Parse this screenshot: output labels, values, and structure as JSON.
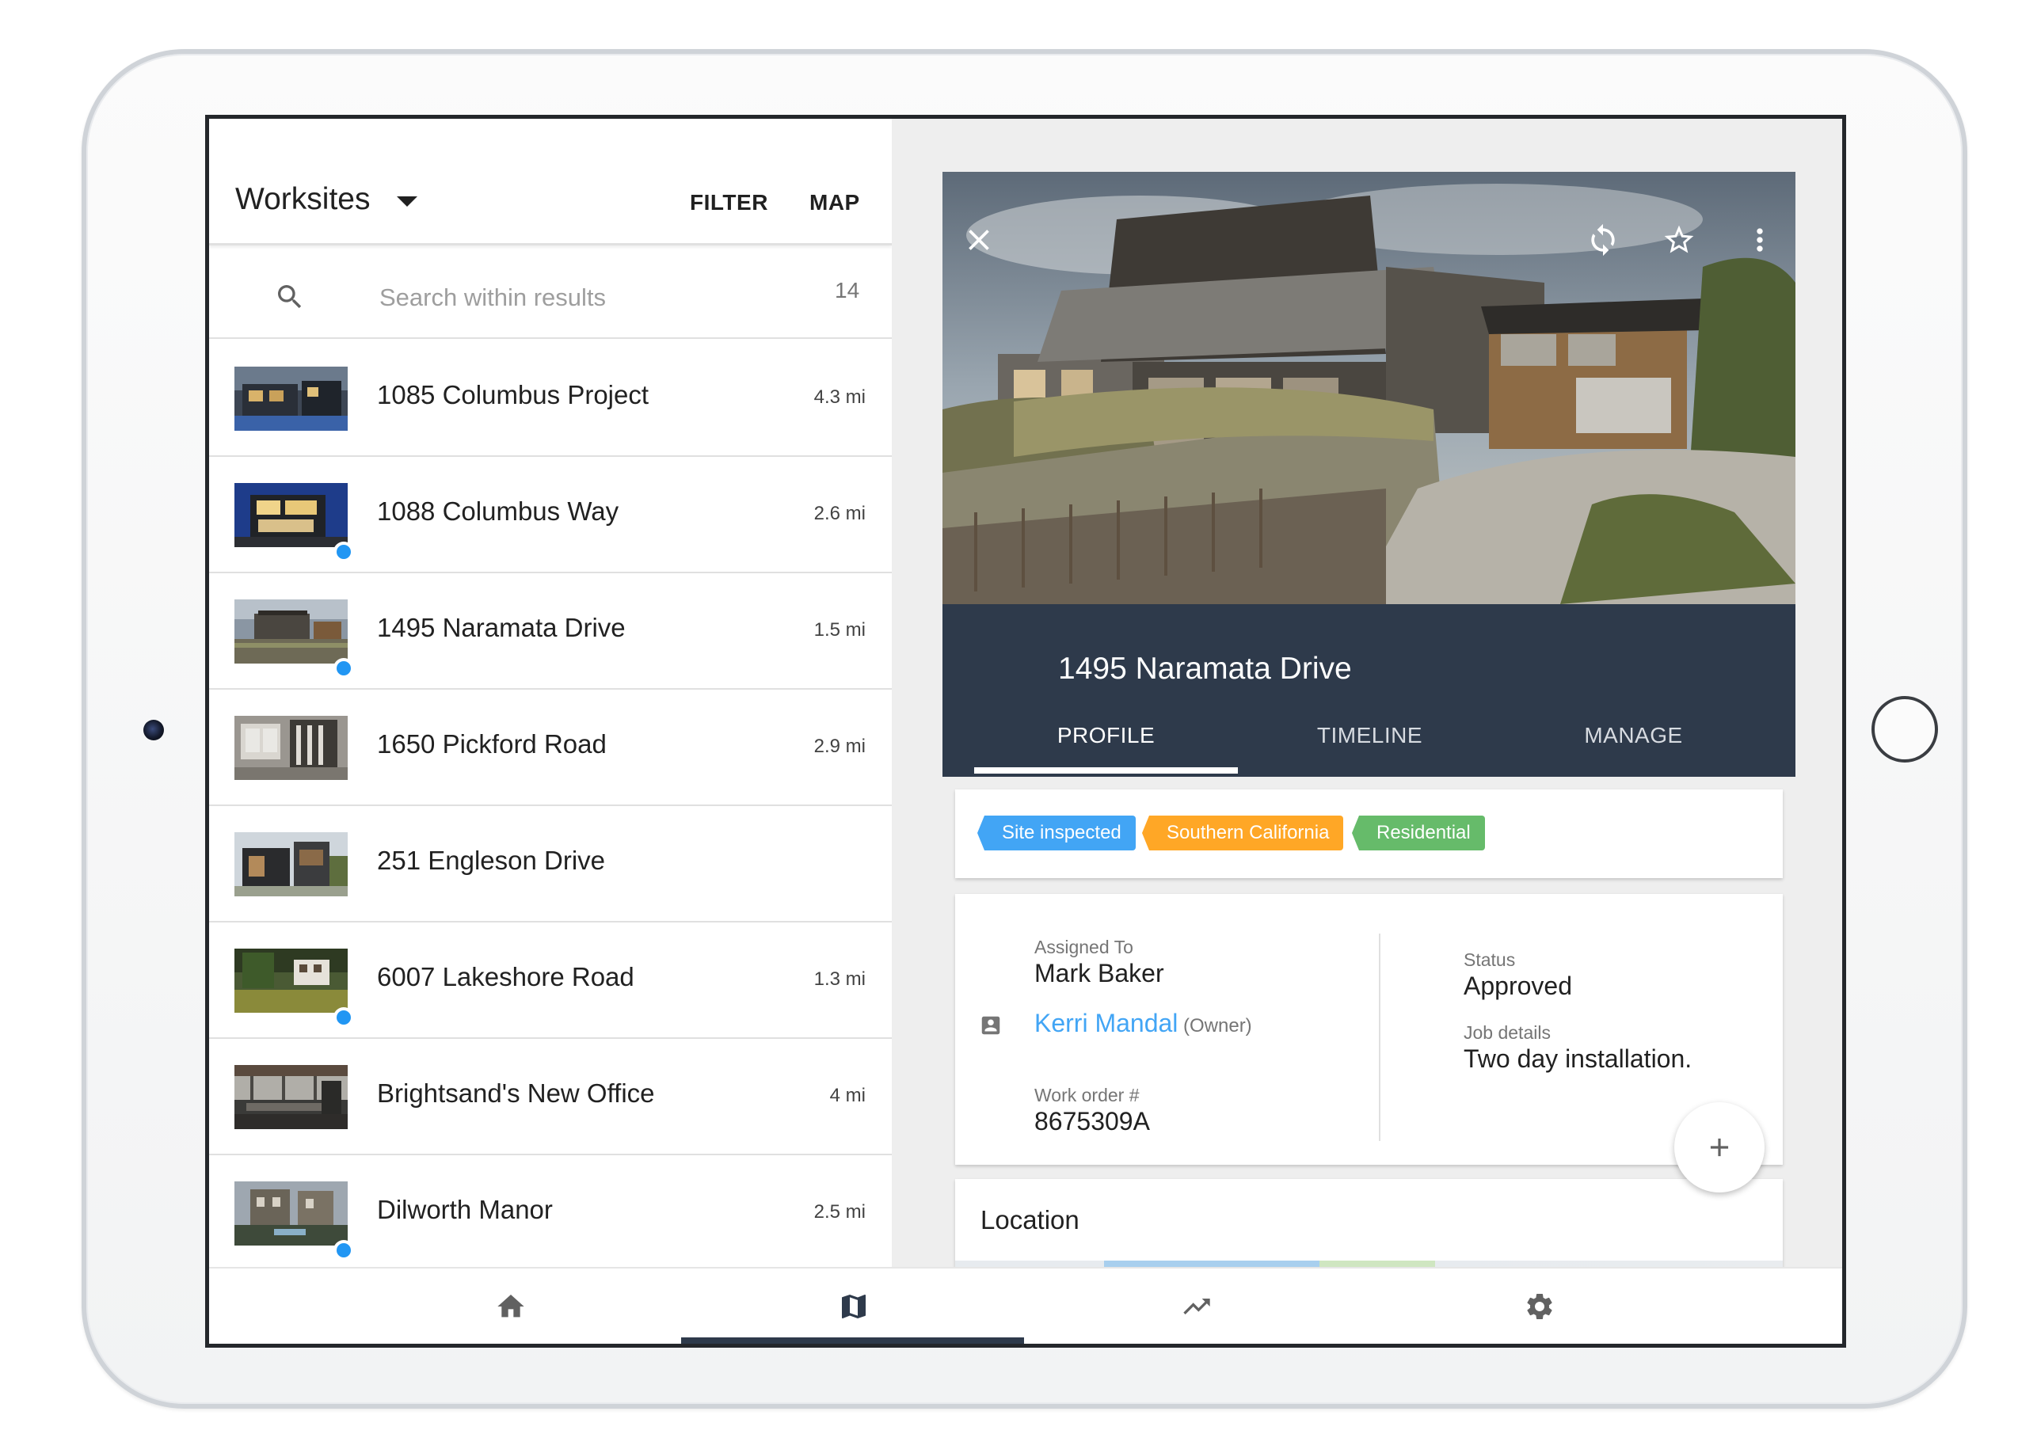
{
  "header": {
    "title": "Worksites",
    "filter_label": "FILTER",
    "map_label": "MAP"
  },
  "search": {
    "placeholder": "Search within results",
    "result_count": "14"
  },
  "worksites": [
    {
      "name": "1085 Columbus Project",
      "distance": "4.3 mi",
      "unread": false
    },
    {
      "name": "1088 Columbus Way",
      "distance": "2.6 mi",
      "unread": true
    },
    {
      "name": "1495 Naramata Drive",
      "distance": "1.5 mi",
      "unread": true
    },
    {
      "name": "1650 Pickford Road",
      "distance": "2.9 mi",
      "unread": false
    },
    {
      "name": "251 Engleson Drive",
      "distance": "",
      "unread": false
    },
    {
      "name": "6007 Lakeshore Road",
      "distance": "1.3 mi",
      "unread": true
    },
    {
      "name": "Brightsand's New Office",
      "distance": "4 mi",
      "unread": false
    },
    {
      "name": "Dilworth Manor",
      "distance": "2.5 mi",
      "unread": true
    }
  ],
  "detail": {
    "title": "1495 Naramata Drive",
    "hero_icons": [
      "close-icon",
      "sync-icon",
      "star-outline-icon",
      "more-vert-icon"
    ],
    "tabs": [
      "PROFILE",
      "TIMELINE",
      "MANAGE"
    ],
    "active_tab": "PROFILE",
    "tags": [
      {
        "label": "Site inspected",
        "color": "#42a5f5"
      },
      {
        "label": "Southern California",
        "color": "#ffa726"
      },
      {
        "label": "Residential",
        "color": "#66bb6a"
      }
    ],
    "assigned_to_label": "Assigned To",
    "assigned_to": "Mark Baker",
    "owner_name": "Kerri Mandal",
    "owner_suffix": "(Owner)",
    "work_order_label": "Work order #",
    "work_order": "8675309A",
    "status_label": "Status",
    "status": "Approved",
    "job_details_label": "Job details",
    "job_details": "Two day installation.",
    "location_label": "Location"
  },
  "bottom_nav": {
    "items": [
      "home-icon",
      "map-icon",
      "trending-up-icon",
      "settings-icon"
    ],
    "active": "map-icon"
  },
  "colors": {
    "accent": "#2e3a4b",
    "link": "#42a5f5",
    "unread_dot": "#2196f3"
  }
}
